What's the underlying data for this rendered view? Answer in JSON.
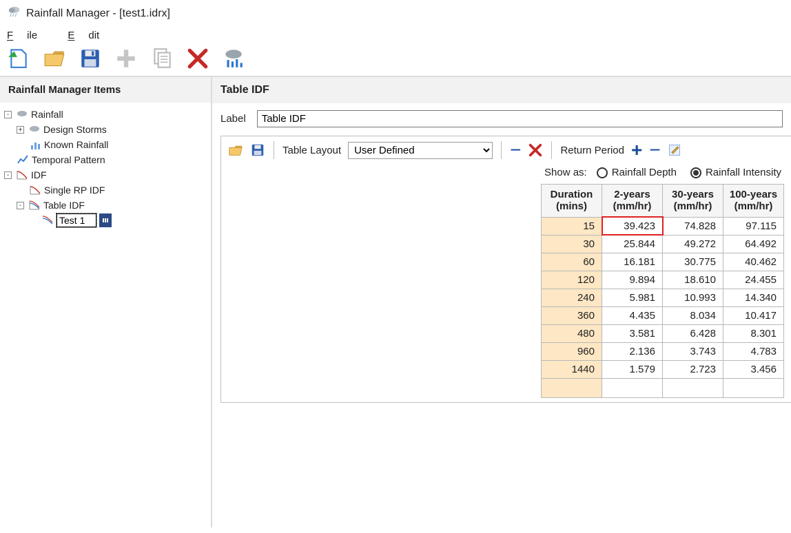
{
  "window": {
    "title": "Rainfall Manager - [test1.idrx]"
  },
  "menu": {
    "file": "File",
    "edit": "Edit"
  },
  "sidebar": {
    "header": "Rainfall Manager Items",
    "rainfall": "Rainfall",
    "design_storms": "Design Storms",
    "known_rainfall": "Known Rainfall",
    "temporal_pattern": "Temporal Pattern",
    "idf": "IDF",
    "single_rp_idf": "Single RP IDF",
    "table_idf": "Table IDF",
    "editing_value": "Test 1"
  },
  "main": {
    "header": "Table IDF",
    "label_text": "Label",
    "label_value": "Table IDF",
    "table_layout_label": "Table Layout",
    "table_layout_value": "User Defined",
    "return_period_label": "Return Period",
    "show_as_label": "Show as:",
    "radio_depth": "Rainfall Depth",
    "radio_intensity": "Rainfall Intensity",
    "radio_selected": "intensity"
  },
  "chart_data": {
    "type": "table",
    "title": "Table IDF",
    "columns": [
      "Duration (mins)",
      "2-years (mm/hr)",
      "30-years (mm/hr)",
      "100-years (mm/hr)"
    ],
    "durations": [
      15,
      30,
      60,
      120,
      240,
      360,
      480,
      960,
      1440
    ],
    "series": [
      {
        "name": "2-years (mm/hr)",
        "values": [
          39.423,
          25.844,
          16.181,
          9.894,
          5.981,
          4.435,
          3.581,
          2.136,
          1.579
        ]
      },
      {
        "name": "30-years (mm/hr)",
        "values": [
          74.828,
          49.272,
          30.775,
          18.61,
          10.993,
          8.034,
          6.428,
          3.743,
          2.723
        ]
      },
      {
        "name": "100-years (mm/hr)",
        "values": [
          97.115,
          64.492,
          40.462,
          24.455,
          14.34,
          10.417,
          8.301,
          4.783,
          3.456
        ]
      }
    ],
    "selected_cell": {
      "row": 0,
      "col": 1
    }
  }
}
